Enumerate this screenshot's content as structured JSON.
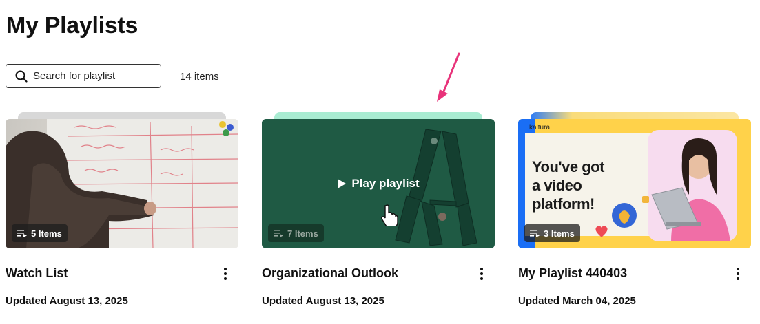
{
  "page": {
    "title": "My Playlists"
  },
  "search": {
    "placeholder": "Search for playlist"
  },
  "summary": {
    "items_count": "14 items"
  },
  "playlists": [
    {
      "title": "Watch List",
      "items": "5 Items",
      "updated": "Updated August 13, 2025"
    },
    {
      "title": "Organizational Outlook",
      "items": "7 Items",
      "updated": "Updated August 13, 2025",
      "hover_action": "Play playlist"
    },
    {
      "title": "My Playlist 440403",
      "items": "3 Items",
      "updated": "Updated March 04, 2025",
      "thumbnail_brand": "kaltura",
      "thumbnail_text": [
        "You've got",
        "a video",
        "platform!"
      ]
    }
  ],
  "colors": {
    "accent_arrow": "#e8337a",
    "card2_bg": "#1f5a44",
    "card3_bg": "#ffd24a"
  },
  "icons": {
    "search": "search-icon",
    "list": "playlist-icon",
    "menu": "kebab-menu-icon",
    "play": "play-icon"
  }
}
